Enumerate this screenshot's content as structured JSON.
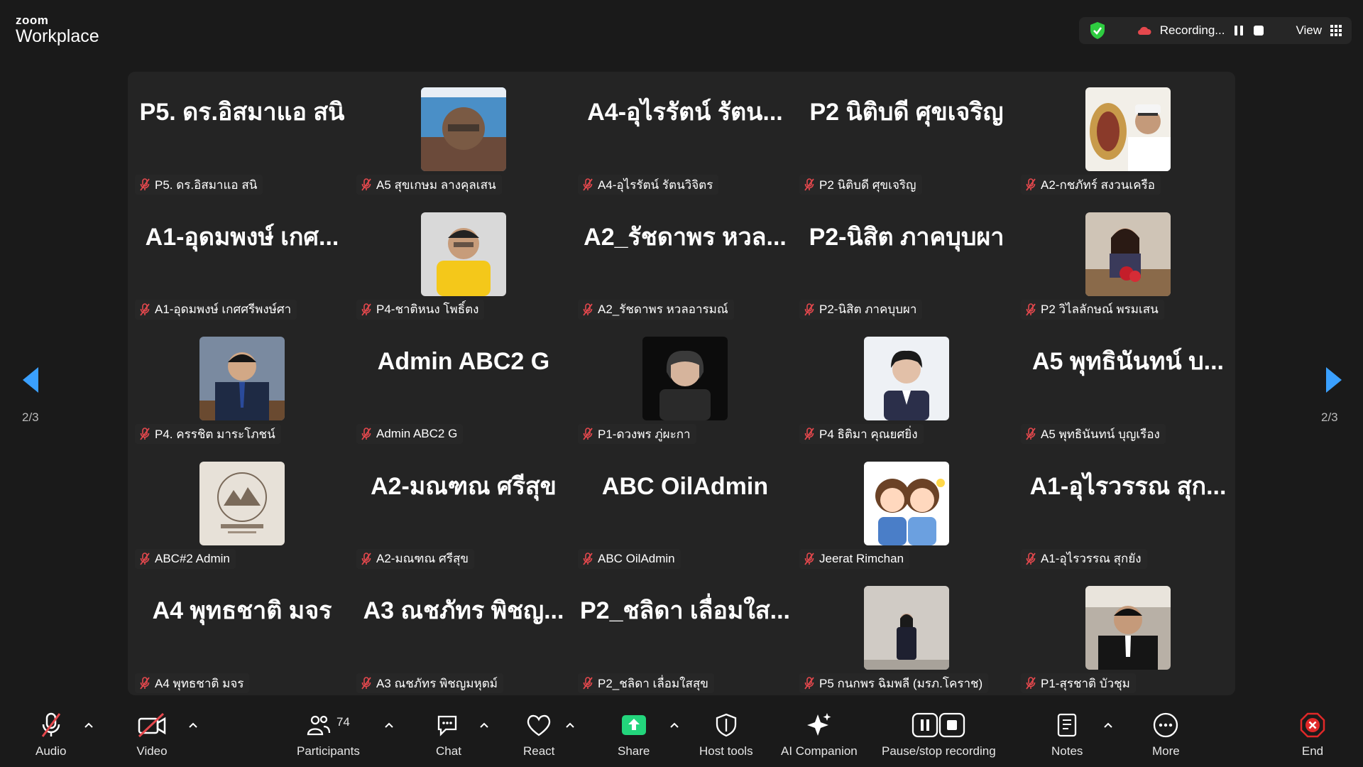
{
  "app": {
    "brand_small": "zoom",
    "brand_large": "Workplace"
  },
  "recording": {
    "text": "Recording...",
    "view_label": "View"
  },
  "pager": {
    "left": "2/3",
    "right": "2/3"
  },
  "tiles": [
    {
      "big": "P5. ดร.อิสมาแอ สนิ",
      "label": "P5. ดร.อิสมาแอ สนิ",
      "photo": null
    },
    {
      "big": null,
      "label": "A5 สุขเกษม ลางคุลเสน",
      "photo": "man-glasses"
    },
    {
      "big": "A4-อุไรรัตน์ รัตน...",
      "label": "A4-อุไรรัตน์ รัตนวิจิตร",
      "photo": null
    },
    {
      "big": "P2 นิติบดี ศุขเจริญ",
      "label": "P2 นิติบดี ศุขเจริญ",
      "photo": null
    },
    {
      "big": null,
      "label": "A2-กชภัทร์ สงวนเครือ",
      "photo": "officer"
    },
    {
      "big": "A1-อุดมพงษ์ เกศ...",
      "label": "A1-อุดมพงษ์ เกศศรีพงษ์ศา",
      "photo": null
    },
    {
      "big": null,
      "label": "P4-ชาติหนง โพธิ์ตง",
      "photo": "man-yellow"
    },
    {
      "big": "A2_รัชดาพร หวล...",
      "label": "A2_รัชดาพร หวลอารมณ์",
      "photo": null
    },
    {
      "big": "P2-นิสิต ภาคบุบผา",
      "label": "P2-นิสิต ภาคบุบผา",
      "photo": null
    },
    {
      "big": null,
      "label": "P2 วิไลลักษณ์ พรมเสน",
      "photo": "woman-flowers"
    },
    {
      "big": null,
      "label": "P4. ครรชิต มาระโภชน์",
      "photo": "man-suit"
    },
    {
      "big": "Admin ABC2 G",
      "label": "Admin ABC2 G",
      "photo": null
    },
    {
      "big": null,
      "label": "P1-ดวงพร ภู่ผะกา",
      "photo": "woman-dark"
    },
    {
      "big": null,
      "label": "P4 ธิติมา คุณยศยิ่ง",
      "photo": "woman-light"
    },
    {
      "big": "A5 พุทธินันทน์ บ...",
      "label": "A5 พุทธินันทน์ บุญเรือง",
      "photo": null
    },
    {
      "big": null,
      "label": "ABC#2 Admin",
      "photo": "logo-stamp"
    },
    {
      "big": "A2-มณฑณ ศรีสุข",
      "label": "A2-มณฑณ ศรีสุข",
      "photo": null
    },
    {
      "big": "ABC OilAdmin",
      "label": "ABC OilAdmin",
      "photo": null
    },
    {
      "big": null,
      "label": "Jeerat Rimchan",
      "photo": "cartoon"
    },
    {
      "big": "A1-อุไรวรรณ สุก...",
      "label": "A1-อุไรวรรณ สุกยัง",
      "photo": null
    },
    {
      "big": "A4 พุทธชาติ มจร",
      "label": "A4 พุทธชาติ มจร",
      "photo": null
    },
    {
      "big": "A3 ณชภัทร พิชญ...",
      "label": "A3 ณชภัทร พิชญมหุตม์",
      "photo": null
    },
    {
      "big": "P2_ชลิดา เลื่อมใส...",
      "label": "P2_ชลิดา เลื่อมใสสุข",
      "photo": null
    },
    {
      "big": null,
      "label": "P5 กนกพร ฉิมพลี (มรภ.โคราช)",
      "photo": "woman-standing"
    },
    {
      "big": null,
      "label": "P1-สุรชาติ บัวชุม",
      "photo": "man-office"
    }
  ],
  "toolbar": {
    "audio": "Audio",
    "video": "Video",
    "participants": "Participants",
    "participants_count": "74",
    "chat": "Chat",
    "react": "React",
    "share": "Share",
    "host_tools": "Host tools",
    "ai_companion": "AI Companion",
    "pause_stop": "Pause/stop recording",
    "notes": "Notes",
    "more": "More",
    "end": "End"
  },
  "colors": {
    "accent_blue": "#3aa0ff",
    "share_green": "#23d57c",
    "mic_red": "#e5484d",
    "end_red": "#e02828",
    "shield_green": "#2ecc40"
  }
}
